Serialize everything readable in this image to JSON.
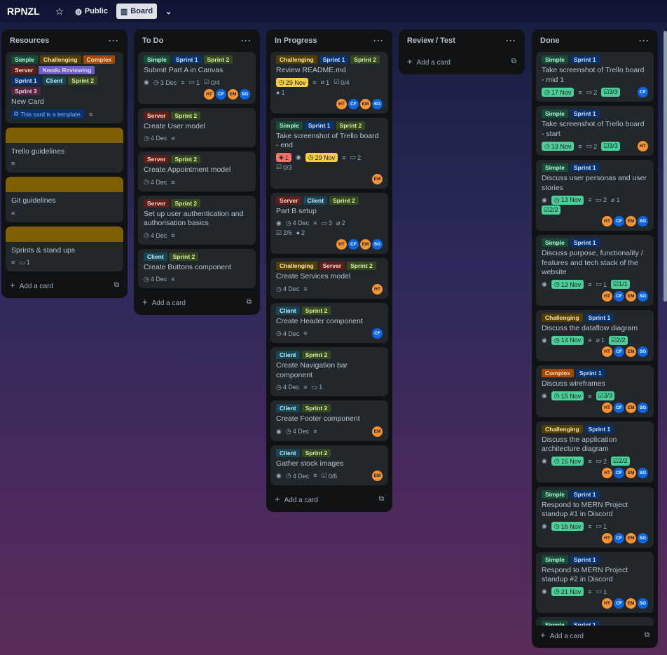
{
  "board": {
    "name": "RPNZL",
    "visibility": "Public",
    "view": "Board"
  },
  "lists": [
    {
      "title": "Resources",
      "add": "Add a card"
    },
    {
      "title": "To Do",
      "add": "Add a card"
    },
    {
      "title": "In Progress",
      "add": "Add a card"
    },
    {
      "title": "Review / Test",
      "add": "Add a card"
    },
    {
      "title": "Done",
      "add": "Add a card"
    }
  ],
  "labels": {
    "simple": "Simple",
    "chal": "Challenging",
    "comp": "Complex",
    "serv": "Server",
    "need": "Needs Reviewing",
    "s1": "Sprint 1",
    "cli": "Client",
    "s2": "Sprint 2",
    "s3": "Sprint 3"
  },
  "avatars": {
    "ht": "HT",
    "cf": "CF",
    "em": "EM",
    "sg": "SG"
  },
  "resources": {
    "c1": {
      "title": "New Card",
      "template": "This card is a template."
    },
    "c2": {
      "title": "Trello guidelines"
    },
    "c3": {
      "title": "Git guidelines"
    },
    "c4": {
      "title": "Sprints & stand ups",
      "comments": "1"
    }
  },
  "todo": {
    "c1": {
      "title": "Submit Part A in Canvas",
      "due": "3 Dec",
      "comments": "1",
      "check": "0/4"
    },
    "c2": {
      "title": "Create User model",
      "due": "4 Dec"
    },
    "c3": {
      "title": "Create Appointment model",
      "due": "4 Dec"
    },
    "c4": {
      "title": "Set up user authentication and authorisation basics",
      "due": "4 Dec"
    },
    "c5": {
      "title": "Create Buttons component",
      "due": "4 Dec"
    }
  },
  "inprog": {
    "c1": {
      "title": "Review README.md",
      "due": "29 Nov",
      "attach": "1",
      "check": "0/4",
      "git": "1"
    },
    "c2": {
      "title": "Take screenshot of Trello board - end",
      "votes": "1",
      "due": "29 Nov",
      "comments": "2",
      "check": "0/3"
    },
    "c3": {
      "title": "Part B setup",
      "due": "4 Dec",
      "comments": "3",
      "attach": "2",
      "check": "2/6",
      "git": "2"
    },
    "c4": {
      "title": "Create Services model",
      "due": "4 Dec"
    },
    "c5": {
      "title": "Create Header component",
      "due": "4 Dec"
    },
    "c6": {
      "title": "Create Navigation bar component",
      "due": "4 Dec",
      "comments": "1"
    },
    "c7": {
      "title": "Create Footer component",
      "due": "4 Dec"
    },
    "c8": {
      "title": "Gather stock images",
      "due": "4 Dec",
      "check": "0/6"
    }
  },
  "done": {
    "c1": {
      "title": "Take screenshot of Trello board - mid 1",
      "due": "17 Nov",
      "comments": "2",
      "check": "3/3"
    },
    "c2": {
      "title": "Take screenshot of Trello board - start",
      "due": "13 Nov",
      "comments": "2",
      "check": "3/3"
    },
    "c3": {
      "title": "Discuss user personas and user stories",
      "due": "13 Nov",
      "comments": "2",
      "attach": "1",
      "check": "2/2"
    },
    "c4": {
      "title": "Discuss purpose, functionality / features and tech stack of the website",
      "due": "13 Nov",
      "comments": "1",
      "check": "1/1"
    },
    "c5": {
      "title": "Discuss the dataflow diagram",
      "due": "14 Nov",
      "attach": "1",
      "check": "2/2"
    },
    "c6": {
      "title": "Discuss wireframes",
      "due": "15 Nov",
      "check": "3/3"
    },
    "c7": {
      "title": "Discuss the application architecture diagram",
      "due": "16 Nov",
      "comments": "2",
      "check": "2/2"
    },
    "c8": {
      "title": "Respond to MERN Project standup #1 in Discord",
      "due": "16 Nov",
      "comments": "1"
    },
    "c9": {
      "title": "Respond to MERN Project standup #2 in Discord",
      "due": "21 Nov",
      "comments": "1"
    }
  }
}
